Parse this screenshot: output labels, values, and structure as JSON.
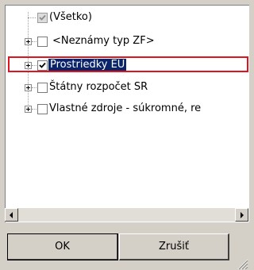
{
  "tree": {
    "items": [
      {
        "label": "(Všetko)",
        "checked": true,
        "disabled": true,
        "has_children": false
      },
      {
        "label": "<Neznámy typ ZF>",
        "checked": false,
        "has_children": true
      },
      {
        "label": "Prostriedky EU",
        "checked": true,
        "selected": true,
        "has_children": true
      },
      {
        "label": "Štátny rozpočet SR",
        "checked": false,
        "has_children": true
      },
      {
        "label": "Vlastné zdroje - súkromné, re",
        "checked": false,
        "has_children": true
      }
    ]
  },
  "buttons": {
    "ok_label": "OK",
    "cancel_label": "Zrušiť"
  },
  "colors": {
    "selection": "#0a246a",
    "focus_outline": "#e0141e",
    "panel_bg": "#ffffff",
    "window_bg": "#d4d0c8"
  },
  "icons": {
    "expand": "plus-box-icon",
    "scroll_left": "arrow-left-icon",
    "scroll_right": "arrow-right-icon",
    "resize": "resize-grip-icon"
  }
}
